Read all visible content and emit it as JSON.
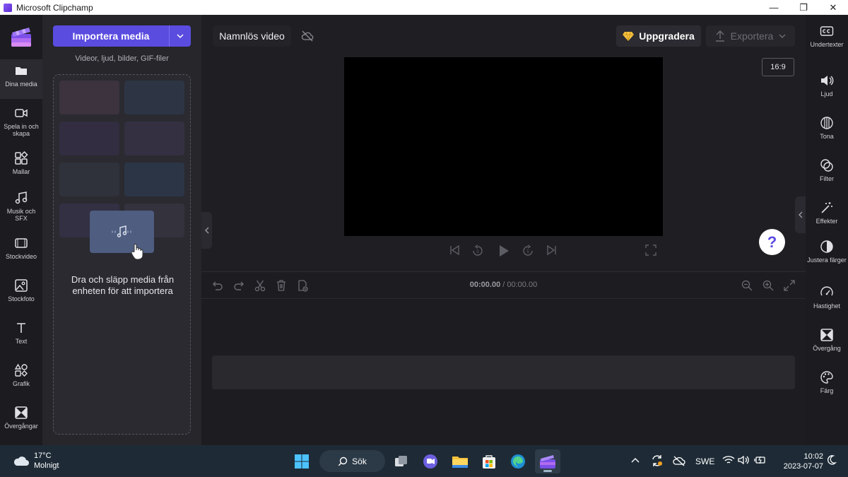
{
  "window": {
    "title": "Microsoft Clipchamp",
    "controls": {
      "minimize": "—",
      "maximize": "❐",
      "close": "✕"
    }
  },
  "left_nav": {
    "items": [
      {
        "label": "Dina media",
        "icon": "folder-icon"
      },
      {
        "label": "Spela in och skapa",
        "icon": "camera-icon"
      },
      {
        "label": "Mallar",
        "icon": "templates-icon"
      },
      {
        "label": "Musik och SFX",
        "icon": "music-icon"
      },
      {
        "label": "Stockvideo",
        "icon": "film-icon"
      },
      {
        "label": "Stockfoto",
        "icon": "image-icon"
      },
      {
        "label": "Text",
        "icon": "text-icon"
      },
      {
        "label": "Grafik",
        "icon": "shapes-icon"
      },
      {
        "label": "Övergångar",
        "icon": "transition-icon"
      }
    ]
  },
  "media_panel": {
    "import_label": "Importera media",
    "import_subtitle": "Videor, ljud, bilder, GIF-filer",
    "dropzone_text": "Dra och släpp media från enheten för att importera"
  },
  "editor": {
    "project_title": "Namnlös video",
    "upgrade_label": "Uppgradera",
    "export_label": "Exportera",
    "aspect_ratio": "16:9",
    "help_label": "?",
    "time_current": "00:00.00",
    "time_separator": " / ",
    "time_total": "00:00.00"
  },
  "right_nav": {
    "items": [
      {
        "label": "Undertexter",
        "icon": "captions-icon"
      },
      {
        "label": "Ljud",
        "icon": "speaker-icon"
      },
      {
        "label": "Tona",
        "icon": "fade-icon"
      },
      {
        "label": "Filter",
        "icon": "filter-icon"
      },
      {
        "label": "Effekter",
        "icon": "magic-wand-icon"
      },
      {
        "label": "Justera färger",
        "icon": "contrast-icon"
      },
      {
        "label": "Hastighet",
        "icon": "speedometer-icon"
      },
      {
        "label": "Övergång",
        "icon": "transition-icon"
      },
      {
        "label": "Färg",
        "icon": "palette-icon"
      }
    ]
  },
  "taskbar": {
    "weather_temp": "17°C",
    "weather_desc": "Molnigt",
    "search_label": "Sök",
    "language": "SWE",
    "time": "10:02",
    "date": "2023-07-07"
  },
  "colors": {
    "accent": "#5b4ce0",
    "background": "#1f1f23",
    "panel": "#26262b",
    "taskbar": "#1e2b36"
  }
}
